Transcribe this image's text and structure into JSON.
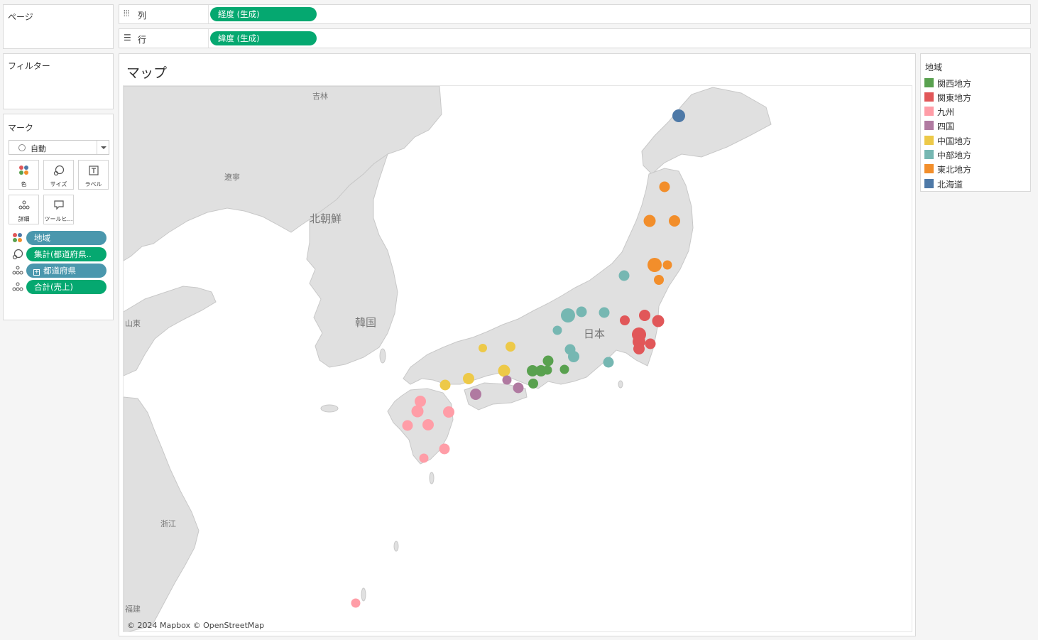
{
  "left_panels": {
    "pages_title": "ページ",
    "filters_title": "フィルター",
    "marks_title": "マーク",
    "mark_type": "自動",
    "mark_buttons": {
      "color": "色",
      "size": "サイズ",
      "label": "ラベル",
      "detail": "詳細",
      "tooltip": "ツールヒ…"
    },
    "mark_pills": {
      "region": "地域",
      "count": "集計(都道府県..",
      "prefecture": "都道府県",
      "sum": "合計(売上)"
    }
  },
  "shelves": {
    "columns_label": "列",
    "columns_pill": "経度 (生成)",
    "rows_label": "行",
    "rows_pill": "緯度 (生成)"
  },
  "viz": {
    "title": "マップ",
    "attribution": "© 2024 Mapbox © OpenStreetMap",
    "map_labels": {
      "jilin": "吉林",
      "liaoning": "遼寧",
      "north_korea": "北朝鮮",
      "south_korea": "韓国",
      "japan": "日本",
      "shandong": "山東",
      "zhejiang": "浙江",
      "fujian": "福建"
    }
  },
  "legend": {
    "title": "地域",
    "items": [
      {
        "label": "関西地方",
        "color": "#59a14f"
      },
      {
        "label": "関東地方",
        "color": "#e15759"
      },
      {
        "label": "九州",
        "color": "#ff9da7"
      },
      {
        "label": "四国",
        "color": "#b07aa1"
      },
      {
        "label": "中国地方",
        "color": "#edc948"
      },
      {
        "label": "中部地方",
        "color": "#76b7b2"
      },
      {
        "label": "東北地方",
        "color": "#f28e2b"
      },
      {
        "label": "北海道",
        "color": "#4e79a7"
      }
    ]
  },
  "colors": {
    "pill_blue": "#4a97ad",
    "pill_green": "#05a870",
    "land": "#e0e0e0",
    "sea": "#ffffff"
  }
}
